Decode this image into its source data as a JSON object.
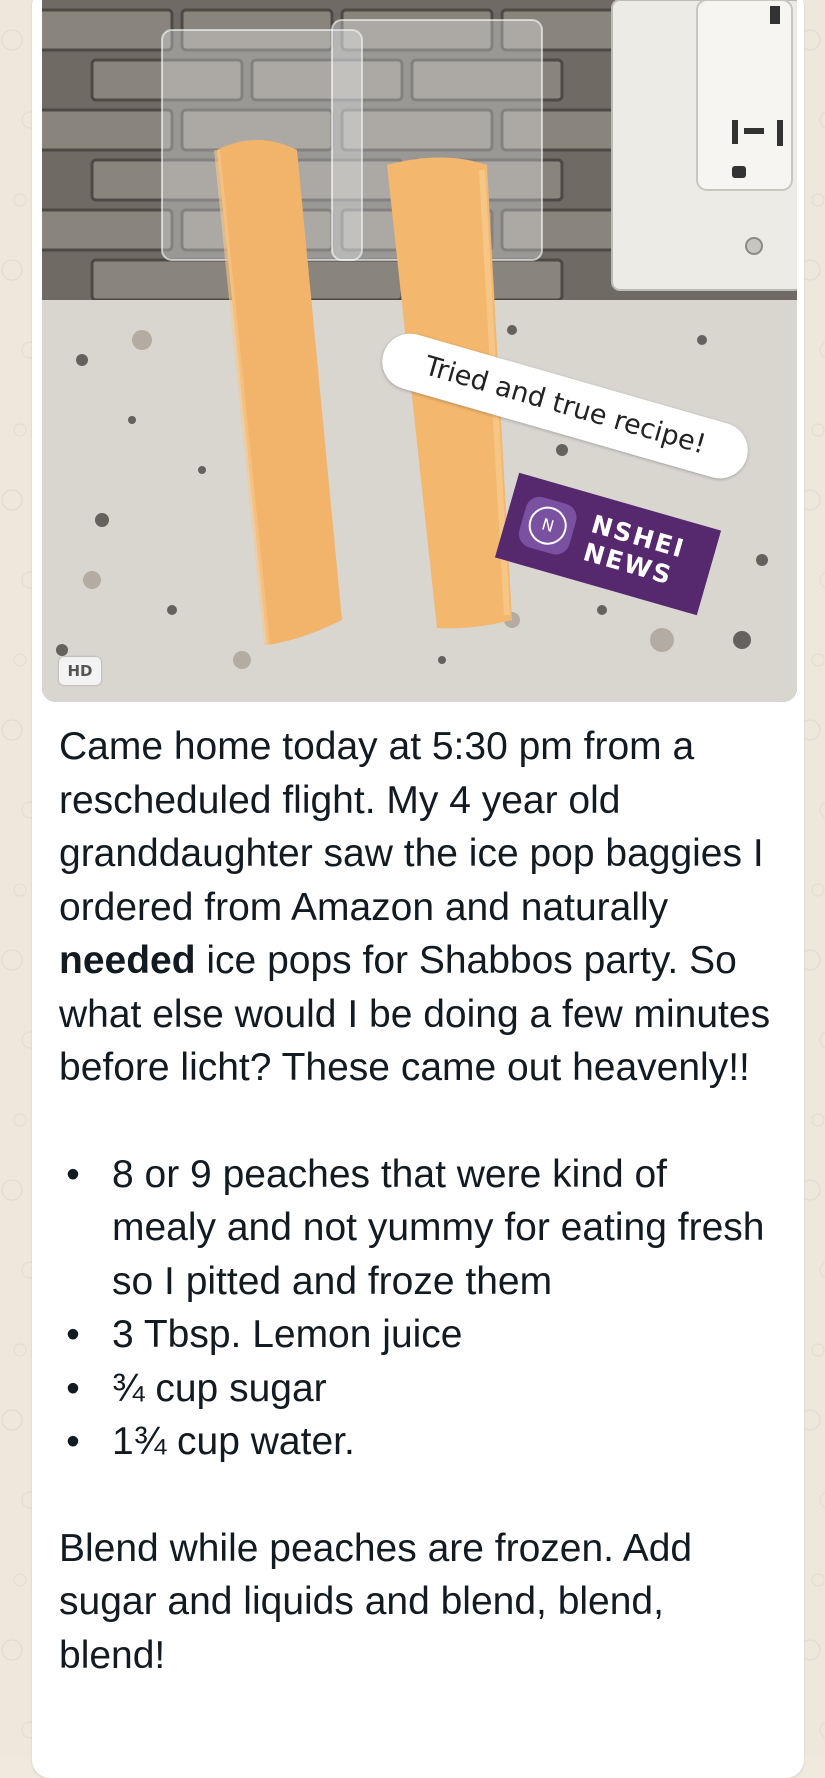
{
  "photo": {
    "badge": "HD",
    "sticker_text": "Tried and true recipe!",
    "logo_mark": "N",
    "logo_line1": "NSHEI",
    "logo_line2": "NEWS"
  },
  "message": {
    "intro_before_bold": "Came home today at 5:30 pm from a rescheduled flight. My 4 year old granddaughter saw the ice pop baggies I ordered from Amazon and naturally ",
    "intro_bold": "needed",
    "intro_after_bold": " ice pops for Shabbos party. So what else would I be doing a few minutes before licht? These came out heavenly!!",
    "bullet_symbol": "•",
    "ingredients": [
      "8 or 9 peaches that were kind of mealy and not yummy for eating fresh so I pitted and froze them",
      "3 Tbsp. Lemon juice",
      "¾ cup sugar",
      "1¾ cup water."
    ],
    "instructions": "Blend while peaches are frozen. Add sugar and liquids and blend, blend, blend!"
  },
  "colors": {
    "wallpaper": "#eee8dc",
    "bubble": "#ffffff",
    "text": "#111b21",
    "brand_purple": "#56296f"
  }
}
